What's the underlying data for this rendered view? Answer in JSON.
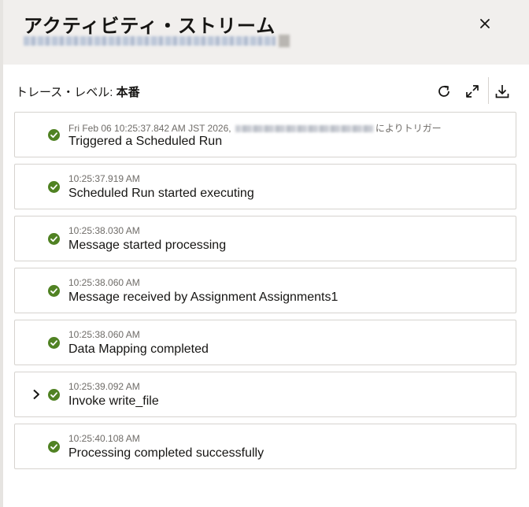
{
  "header": {
    "title": "アクティビティ・ストリーム"
  },
  "toolbar": {
    "trace_label": "トレース・レベル: ",
    "trace_value": "本番"
  },
  "icons": {
    "close": "close-icon",
    "refresh": "refresh-icon",
    "expand": "expand-icon",
    "download": "download-icon",
    "status": "success-check-icon"
  },
  "colors": {
    "success": "#508223",
    "header_bg": "#f1efed",
    "border": "#d6d3cf"
  },
  "activities": [
    {
      "time": "Fri Feb 06 10:25:37.842 AM JST 2026, ",
      "suffix": "によりトリガー",
      "message": "Triggered a Scheduled Run",
      "expandable": false
    },
    {
      "time": "10:25:37.919 AM",
      "suffix": "",
      "message": "Scheduled Run started executing",
      "expandable": false
    },
    {
      "time": "10:25:38.030 AM",
      "suffix": "",
      "message": "Message started processing",
      "expandable": false
    },
    {
      "time": "10:25:38.060 AM",
      "suffix": "",
      "message": "Message received by Assignment Assignments1",
      "expandable": false
    },
    {
      "time": "10:25:38.060 AM",
      "suffix": "",
      "message": "Data Mapping completed",
      "expandable": false
    },
    {
      "time": "10:25:39.092 AM",
      "suffix": "",
      "message": "Invoke write_file",
      "expandable": true
    },
    {
      "time": "10:25:40.108 AM",
      "suffix": "",
      "message": "Processing completed successfully",
      "expandable": false
    }
  ]
}
